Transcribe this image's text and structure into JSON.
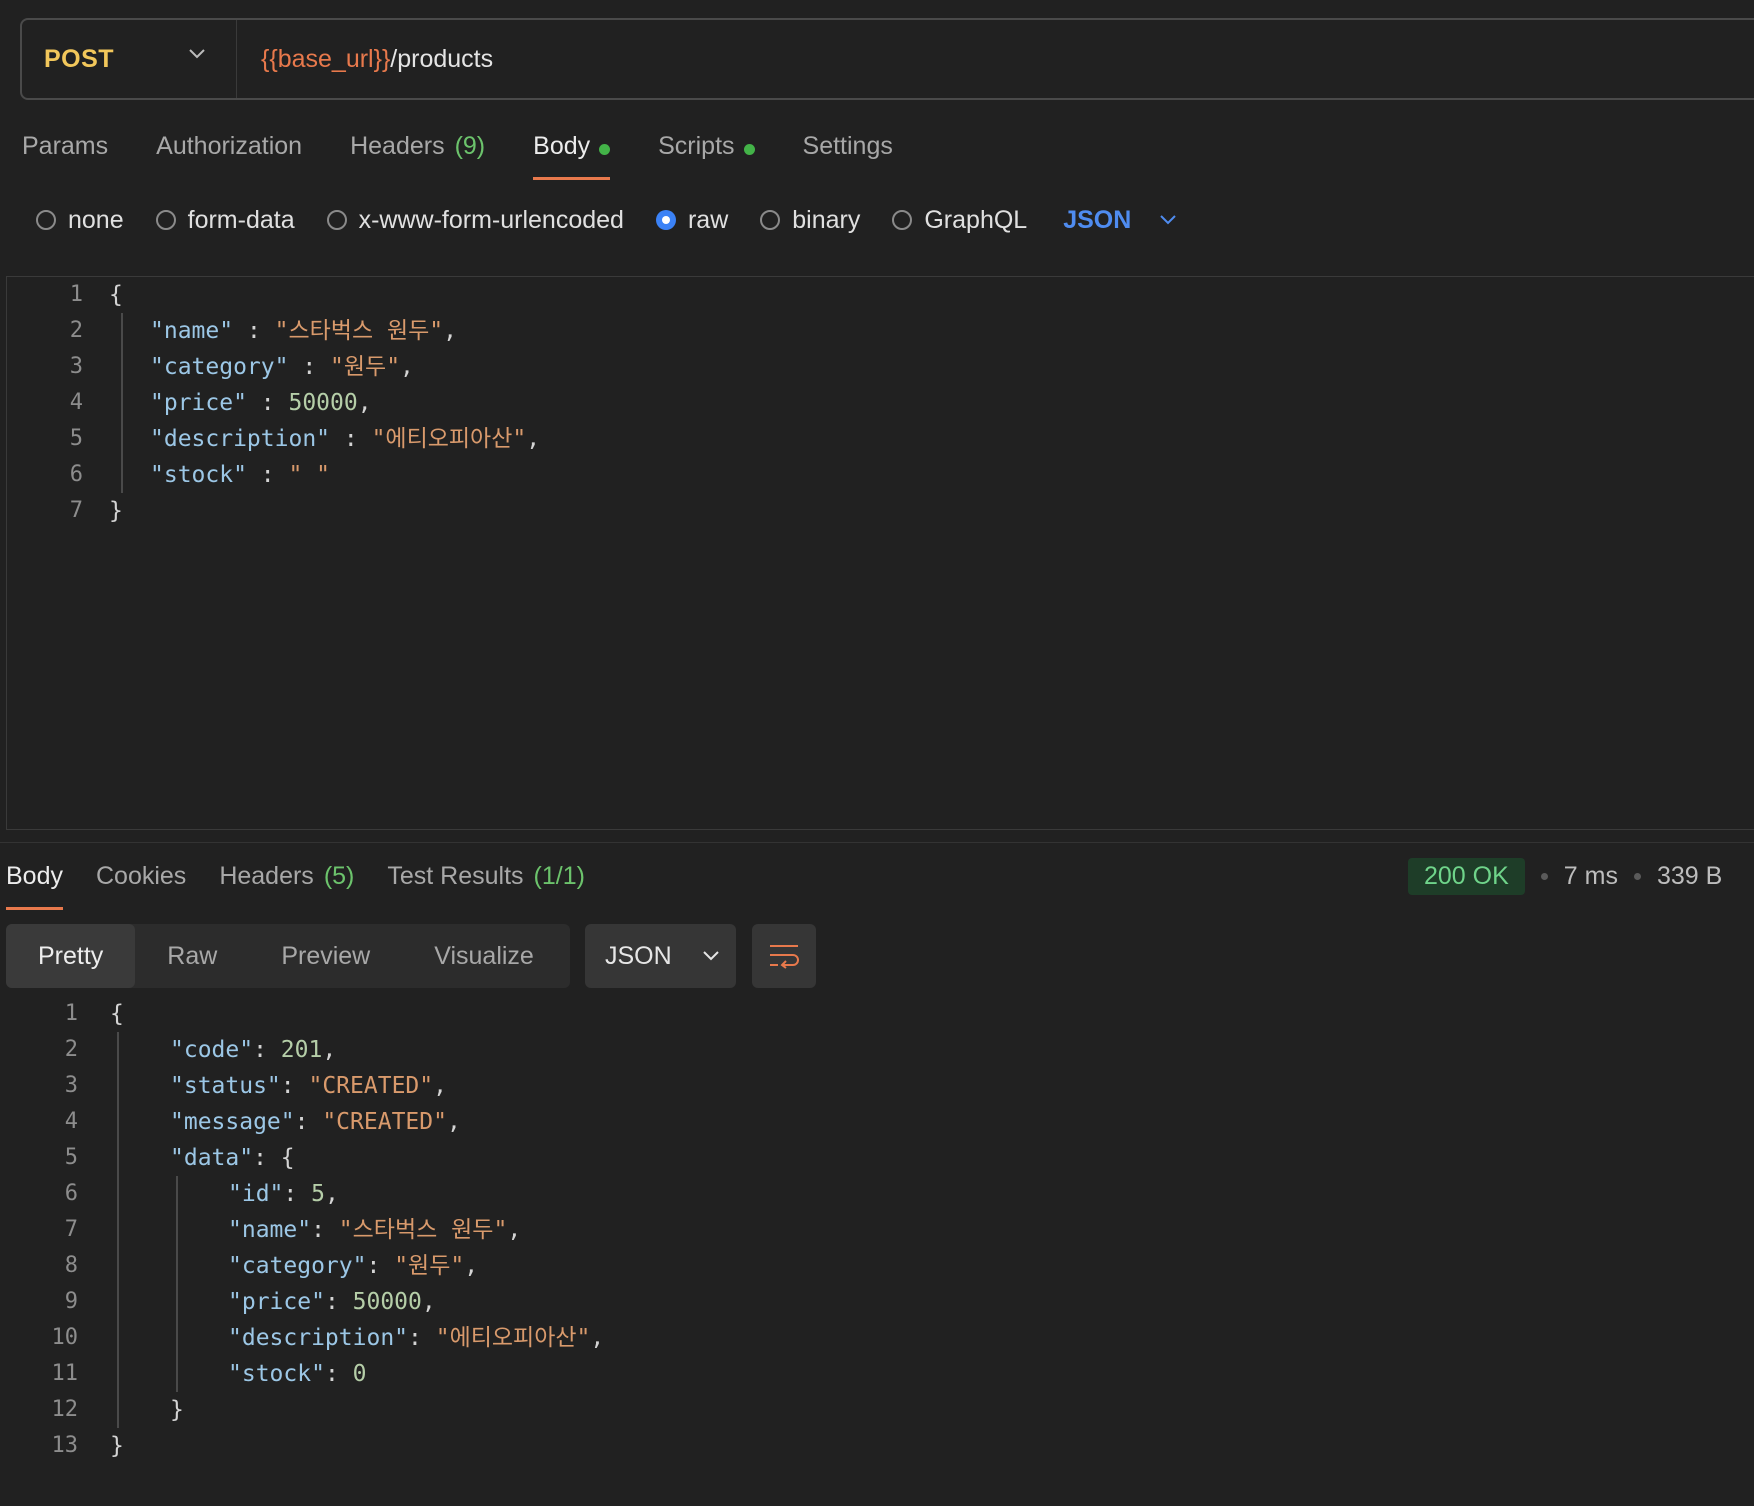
{
  "request": {
    "method": "POST",
    "url_variable": "{{base_url}}",
    "url_path": "/products"
  },
  "request_tabs": [
    {
      "label": "Params"
    },
    {
      "label": "Authorization"
    },
    {
      "label": "Headers",
      "count": "(9)"
    },
    {
      "label": "Body"
    },
    {
      "label": "Scripts"
    },
    {
      "label": "Settings"
    }
  ],
  "body_types": {
    "none": "none",
    "form_data": "form-data",
    "urlencoded": "x-www-form-urlencoded",
    "raw": "raw",
    "binary": "binary",
    "graphql": "GraphQL",
    "language": "JSON"
  },
  "request_body_lines": [
    {
      "n": "1",
      "text": "{"
    },
    {
      "n": "2",
      "key": "\"name\"",
      "sep": " : ",
      "val": "\"스타벅스 원두\"",
      "tail": ","
    },
    {
      "n": "3",
      "key": "\"category\"",
      "sep": " : ",
      "val": "\"원두\"",
      "tail": ","
    },
    {
      "n": "4",
      "key": "\"price\"",
      "sep": " : ",
      "val": "50000",
      "tail": ","
    },
    {
      "n": "5",
      "key": "\"description\"",
      "sep": " : ",
      "val": "\"에티오피아산\"",
      "tail": ","
    },
    {
      "n": "6",
      "key": "\"stock\"",
      "sep": " : ",
      "val": "\" \"",
      "tail": ""
    },
    {
      "n": "7",
      "text": "}"
    }
  ],
  "response_tabs": [
    {
      "label": "Body"
    },
    {
      "label": "Cookies"
    },
    {
      "label": "Headers",
      "count": "(5)"
    },
    {
      "label": "Test Results",
      "count": "(1/1)"
    }
  ],
  "response_status": {
    "status": "200 OK",
    "time": "7 ms",
    "size": "339 B"
  },
  "view_modes": [
    "Pretty",
    "Raw",
    "Preview",
    "Visualize"
  ],
  "response_format": "JSON",
  "response_body_lines": [
    {
      "n": "1",
      "text": "{"
    },
    {
      "n": "2",
      "key": "\"code\"",
      "val": "201",
      "tail": ","
    },
    {
      "n": "3",
      "key": "\"status\"",
      "val": "\"CREATED\"",
      "tail": ","
    },
    {
      "n": "4",
      "key": "\"message\"",
      "val": "\"CREATED\"",
      "tail": ","
    },
    {
      "n": "5",
      "key": "\"data\"",
      "val": "{",
      "tail": ""
    },
    {
      "n": "6",
      "key": "\"id\"",
      "val": "5",
      "tail": ","
    },
    {
      "n": "7",
      "key": "\"name\"",
      "val": "\"스타벅스 원두\"",
      "tail": ","
    },
    {
      "n": "8",
      "key": "\"category\"",
      "val": "\"원두\"",
      "tail": ","
    },
    {
      "n": "9",
      "key": "\"price\"",
      "val": "50000",
      "tail": ","
    },
    {
      "n": "10",
      "key": "\"description\"",
      "val": "\"에티오피아산\"",
      "tail": ","
    },
    {
      "n": "11",
      "key": "\"stock\"",
      "val": "0",
      "tail": ""
    },
    {
      "n": "12",
      "text": "}"
    },
    {
      "n": "13",
      "text": "}"
    }
  ]
}
